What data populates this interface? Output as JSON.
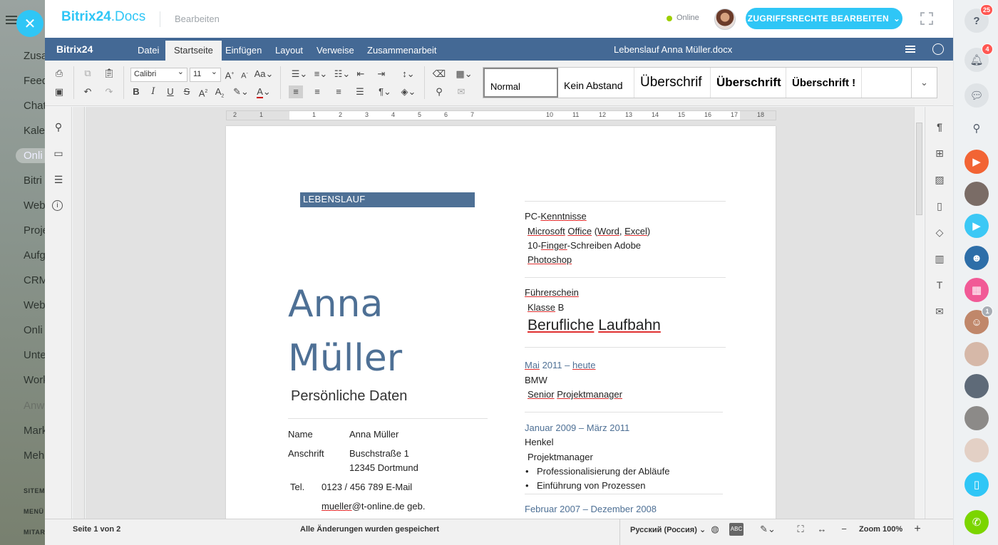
{
  "bg_menu": {
    "items": [
      "Zusa",
      "Feed",
      "Chat",
      "Kale",
      "Onli",
      "Bitri",
      "Web",
      "Proje",
      "Aufg",
      "CRM",
      "Web",
      "Onli",
      "Unte",
      "Work",
      "Anw",
      "Mark",
      "Meh"
    ],
    "small": [
      "SITEM",
      "MENÜ",
      "MITAR"
    ]
  },
  "topbar": {
    "logo_a": "Bitrix24",
    "logo_b": ".Docs",
    "mode": "Bearbeiten",
    "status": "Online",
    "access_button": "ZUGRIFFSRECHTE BEARBEITEN"
  },
  "menubar": {
    "brand": "Bitrix24",
    "tabs": [
      "Datei",
      "Startseite",
      "Einfügen",
      "Layout",
      "Verweise",
      "Zusammenarbeit"
    ],
    "active_tab": "Startseite",
    "doc_title": "Lebenslauf Anna Müller.docx"
  },
  "toolbar": {
    "font": "Calibri",
    "size": "11",
    "styles": [
      "Normal",
      "Kein Abstand",
      "Überschrif",
      "Überschrift",
      "Überschrift !"
    ]
  },
  "ruler": [
    "2",
    "1",
    "1",
    "2",
    "3",
    "4",
    "5",
    "6",
    "7",
    "10",
    "11",
    "12",
    "13",
    "14",
    "15",
    "16",
    "17",
    "18"
  ],
  "document": {
    "banner": "LEBENSLAUF",
    "first_name": "Anna",
    "last_name": "Müller",
    "personal_heading": "Persönliche Daten",
    "name_label": "Name",
    "name_value": "Anna Müller",
    "address_label": "Anschrift",
    "address_line1": "Buschstraße 1",
    "address_line2": "12345 Dortmund",
    "tel_label": "Tel.",
    "tel_value": "0123 / 456 789 E-Mail",
    "email_a": "mueller",
    "email_b": "@t-online.de geb.",
    "pc_a": "PC-",
    "pc_b": "Kenntnisse",
    "office": {
      "microsoft": "Microsoft",
      "office": "Office",
      "paren_open": " (",
      "word": "Word",
      "comma": ", ",
      "excel": "Excel",
      "paren_close": ")"
    },
    "typing": {
      "a": "10-",
      "finger": "Finger",
      "dash": "-",
      "schreiben": "Schreiben",
      "adobe": " Adobe"
    },
    "photoshop": "Photoshop",
    "license_heading": "Führerschein",
    "license_class_a": "Klasse",
    "license_class_b": " B",
    "career_heading_a": "Berufliche",
    "career_heading_b": "Laufbahn",
    "job1": {
      "date_a": "Mai",
      "date_b": " 2011 – ",
      "date_c": "heute",
      "company": "BMW",
      "title_a": "Senior",
      "title_b": "Projektmanager"
    },
    "job2": {
      "date": "Januar 2009 – März 2011",
      "company": "Henkel",
      "title": "Projektmanager",
      "bullets": [
        "Professionalisierung der Abläufe",
        "Einführung von Prozessen"
      ]
    },
    "job3": {
      "date": "Februar 2007 – Dezember 2008"
    }
  },
  "statusbar": {
    "page": "Seite 1 von 2",
    "saved": "Alle Änderungen wurden gespeichert",
    "language": "Русский (Россия)",
    "zoom": "Zoom 100%"
  },
  "messenger": {
    "badges": {
      "help": "25",
      "notifications": "4",
      "group": "1"
    }
  },
  "colors": {
    "accent": "#2fc6f6",
    "editor_blue": "#446995",
    "doc_blue": "#4e7095"
  }
}
